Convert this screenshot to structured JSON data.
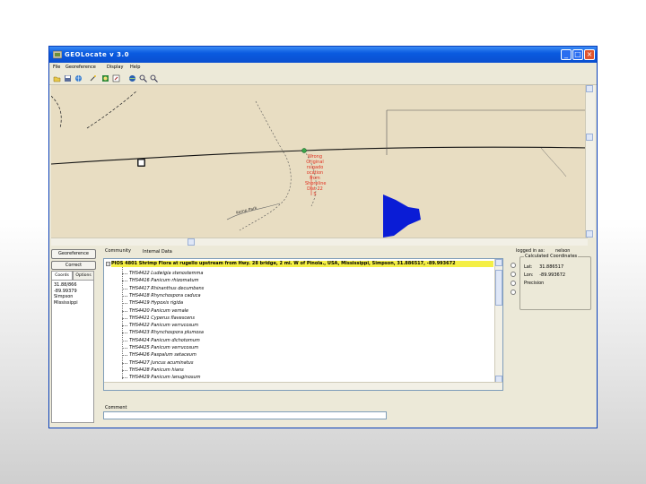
{
  "window": {
    "title": "GEOLocate v 3.0",
    "minimize": "_",
    "maximize": "□",
    "close": "×"
  },
  "menu": [
    "File",
    "Georeference",
    "Display",
    "Help"
  ],
  "toolbar_icons": [
    "open-icon",
    "save-icon",
    "globe-icon",
    "wand-icon",
    "map-icon",
    "edit-icon",
    "globe-small-icon",
    "zoom-in-icon",
    "zoom-out-icon"
  ],
  "map": {
    "label_lines": [
      "Wrong",
      "Original",
      "rsigado",
      "ocation",
      "from",
      "Shoreline",
      "Dist 22",
      "S"
    ],
    "road_text": "Kemp Park"
  },
  "left_panel": {
    "georeference_button": "Georeference",
    "correct_button": "Correct",
    "tabs": [
      "Coords",
      "Options"
    ],
    "coords": [
      "31.88/866",
      "-89.99379",
      "Simpson",
      "Mississippi"
    ]
  },
  "labels": {
    "community": "Community",
    "tree_header": "Internal Data",
    "comment": "Comment"
  },
  "tree": {
    "root": "PIOS 4801 Shrimp Flora at rugello upstream from Hwy. 28 bridge, 2 mi. W of Pinola., USA, Mississippi, Simpson, 31.886517, -89.993672",
    "children": [
      "THS4422 Ludwigia stenostemma",
      "THS4416 Panicum rhizomatum",
      "THS4417 Rhinanthus decumbens",
      "THS4418 Rhynchospora caduca",
      "THS4419 Hypoxis rigida",
      "THS4420 Panicum vernale",
      "THS4421 Cyperus flavescens",
      "THS4422 Panicum verrucosum",
      "THS4423 Rhynchospora plumosa",
      "THS4424 Panicum dichotomum",
      "THS4425 Panicum verrucosum",
      "THS4426 Paspalum setaceum",
      "THS4427 Juncus acuminatus",
      "THS4428 Panicum hians",
      "THS4429 Panicum lanuginosum"
    ]
  },
  "right_panel": {
    "logged_label": "logged in as:",
    "user": "nelson",
    "calc_title": "Calculated Coordinates",
    "lat_label": "Lat:",
    "lat_value": "31.886517",
    "lon_label": "Lon:",
    "lon_value": "-89.993672",
    "precision_label": "Precision"
  },
  "colors": {
    "map_bg": "#e8ddc2",
    "highlight": "#f4ef45",
    "marker_red": "#e03020",
    "polygon_blue": "#0a1cd6",
    "titlebar": "#0a5be0"
  }
}
